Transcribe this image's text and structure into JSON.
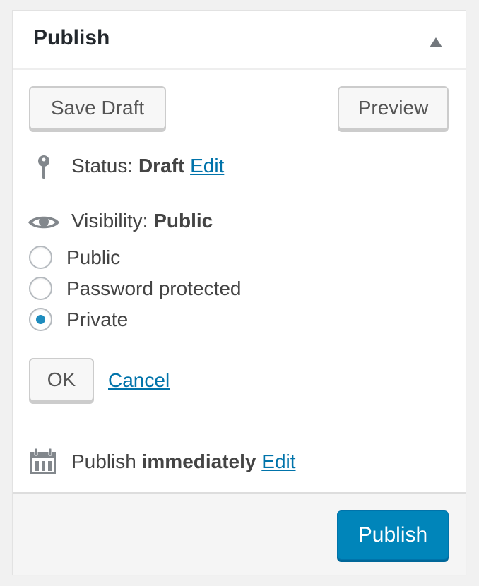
{
  "header": {
    "title": "Publish",
    "toggle_icon": "triangle-up-icon"
  },
  "actions": {
    "save_draft_label": "Save Draft",
    "preview_label": "Preview"
  },
  "status": {
    "icon": "key-icon",
    "label": "Status:",
    "value": "Draft",
    "edit_label": "Edit"
  },
  "visibility": {
    "icon": "eye-icon",
    "label": "Visibility:",
    "value": "Public",
    "options": [
      {
        "label": "Public",
        "checked": false
      },
      {
        "label": "Password protected",
        "checked": false
      },
      {
        "label": "Private",
        "checked": true
      }
    ],
    "ok_label": "OK",
    "cancel_label": "Cancel"
  },
  "schedule": {
    "icon": "calendar-icon",
    "label": "Publish",
    "value": "immediately",
    "edit_label": "Edit"
  },
  "footer": {
    "publish_label": "Publish"
  },
  "colors": {
    "accent": "#0085ba",
    "link": "#0073aa",
    "radio_checked": "#1e8cbe"
  }
}
